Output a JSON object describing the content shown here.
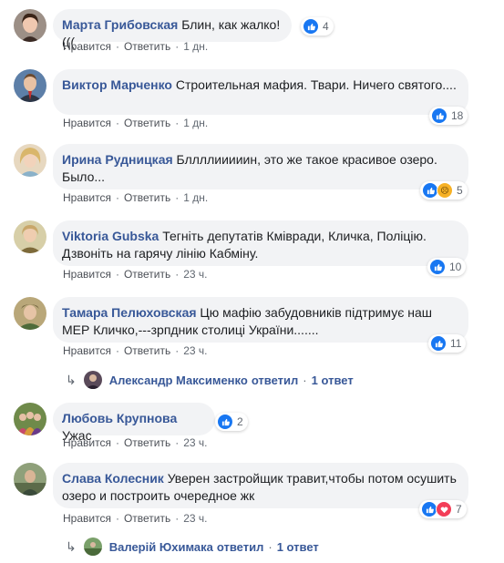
{
  "actions": {
    "like": "Нравится",
    "reply": "Ответить",
    "sep": "·"
  },
  "comments": [
    {
      "author": "Марта Грибовская",
      "text": "Блин, как жалко!(((",
      "time": "1 дн.",
      "reactions": "4"
    },
    {
      "author": "Виктор Марченко",
      "text": "Строительная мафия. Твари. Ничего святого....",
      "time": "1 дн.",
      "reactions": "18"
    },
    {
      "author": "Ирина Рудницкая",
      "text": "Бллллииииин, это же такое красивое озеро. Было...",
      "time": "1 дн.",
      "reactions": "5"
    },
    {
      "author": "Viktoria Gubska",
      "text": "Тегніть депутатів Кмівради, Кличка, Поліцію. Дзвоніть на гарячу лінію Кабміну.",
      "time": "23 ч.",
      "reactions": "10"
    },
    {
      "author": "Тамара Пелюховская",
      "text": "Цю мафію забудовників підтримує наш МЕР Кличко,---зрпдник столиці України.......",
      "time": "23 ч.",
      "reactions": "11",
      "reply": {
        "name": "Александр Максименко",
        "verb": "ответил",
        "count": "1 ответ"
      }
    },
    {
      "author": "Любовь Крупнова",
      "text": "Ужас",
      "time": "23 ч.",
      "reactions": "2"
    },
    {
      "author": "Слава Колесник",
      "text": "Уверен застройщик травит,чтобы потом осушить озеро и построить очередное жк",
      "time": "23 ч.",
      "reactions": "7",
      "reply": {
        "name": "Валерій Юхимака",
        "verb": "ответил",
        "count": "1 ответ"
      }
    }
  ],
  "colors": {
    "author": "#385898",
    "bubble": "#f2f3f5",
    "like": "#1877f2"
  }
}
